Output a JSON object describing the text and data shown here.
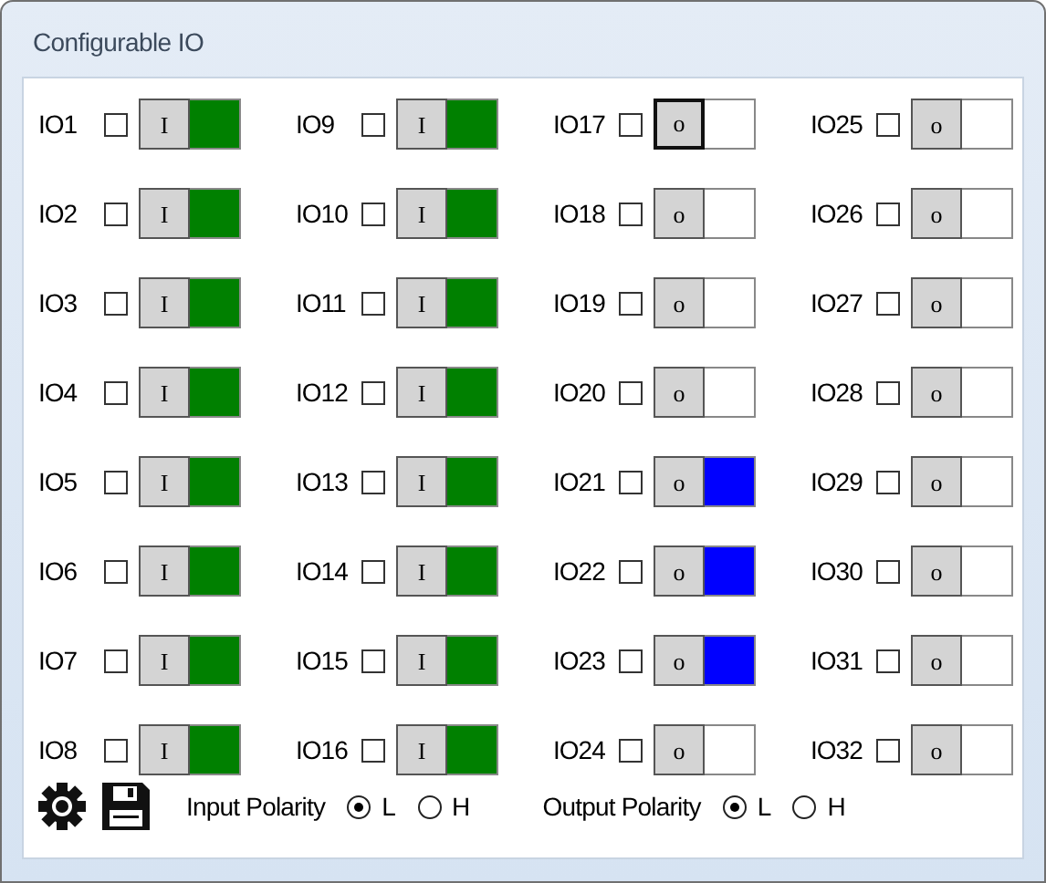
{
  "window": {
    "title": "Configurable IO"
  },
  "ios": [
    {
      "label": "IO1",
      "checked": false,
      "direction": "I",
      "color": "#008000",
      "focused": false
    },
    {
      "label": "IO2",
      "checked": false,
      "direction": "I",
      "color": "#008000",
      "focused": false
    },
    {
      "label": "IO3",
      "checked": false,
      "direction": "I",
      "color": "#008000",
      "focused": false
    },
    {
      "label": "IO4",
      "checked": false,
      "direction": "I",
      "color": "#008000",
      "focused": false
    },
    {
      "label": "IO5",
      "checked": false,
      "direction": "I",
      "color": "#008000",
      "focused": false
    },
    {
      "label": "IO6",
      "checked": false,
      "direction": "I",
      "color": "#008000",
      "focused": false
    },
    {
      "label": "IO7",
      "checked": false,
      "direction": "I",
      "color": "#008000",
      "focused": false
    },
    {
      "label": "IO8",
      "checked": false,
      "direction": "I",
      "color": "#008000",
      "focused": false
    },
    {
      "label": "IO9",
      "checked": false,
      "direction": "I",
      "color": "#008000",
      "focused": false
    },
    {
      "label": "IO10",
      "checked": false,
      "direction": "I",
      "color": "#008000",
      "focused": false
    },
    {
      "label": "IO11",
      "checked": false,
      "direction": "I",
      "color": "#008000",
      "focused": false
    },
    {
      "label": "IO12",
      "checked": false,
      "direction": "I",
      "color": "#008000",
      "focused": false
    },
    {
      "label": "IO13",
      "checked": false,
      "direction": "I",
      "color": "#008000",
      "focused": false
    },
    {
      "label": "IO14",
      "checked": false,
      "direction": "I",
      "color": "#008000",
      "focused": false
    },
    {
      "label": "IO15",
      "checked": false,
      "direction": "I",
      "color": "#008000",
      "focused": false
    },
    {
      "label": "IO16",
      "checked": false,
      "direction": "I",
      "color": "#008000",
      "focused": false
    },
    {
      "label": "IO17",
      "checked": false,
      "direction": "o",
      "color": "#ffffff",
      "focused": true
    },
    {
      "label": "IO18",
      "checked": false,
      "direction": "o",
      "color": "#ffffff",
      "focused": false
    },
    {
      "label": "IO19",
      "checked": false,
      "direction": "o",
      "color": "#ffffff",
      "focused": false
    },
    {
      "label": "IO20",
      "checked": false,
      "direction": "o",
      "color": "#ffffff",
      "focused": false
    },
    {
      "label": "IO21",
      "checked": false,
      "direction": "o",
      "color": "#0000ff",
      "focused": false
    },
    {
      "label": "IO22",
      "checked": false,
      "direction": "o",
      "color": "#0000ff",
      "focused": false
    },
    {
      "label": "IO23",
      "checked": false,
      "direction": "o",
      "color": "#0000ff",
      "focused": false
    },
    {
      "label": "IO24",
      "checked": false,
      "direction": "o",
      "color": "#ffffff",
      "focused": false
    },
    {
      "label": "IO25",
      "checked": false,
      "direction": "o",
      "color": "#ffffff",
      "focused": false
    },
    {
      "label": "IO26",
      "checked": false,
      "direction": "o",
      "color": "#ffffff",
      "focused": false
    },
    {
      "label": "IO27",
      "checked": false,
      "direction": "o",
      "color": "#ffffff",
      "focused": false
    },
    {
      "label": "IO28",
      "checked": false,
      "direction": "o",
      "color": "#ffffff",
      "focused": false
    },
    {
      "label": "IO29",
      "checked": false,
      "direction": "o",
      "color": "#ffffff",
      "focused": false
    },
    {
      "label": "IO30",
      "checked": false,
      "direction": "o",
      "color": "#ffffff",
      "focused": false
    },
    {
      "label": "IO31",
      "checked": false,
      "direction": "o",
      "color": "#ffffff",
      "focused": false
    },
    {
      "label": "IO32",
      "checked": false,
      "direction": "o",
      "color": "#ffffff",
      "focused": false
    }
  ],
  "polarity": [
    {
      "label": "Input Polarity",
      "options": [
        {
          "label": "L",
          "selected": true
        },
        {
          "label": "H",
          "selected": false
        }
      ]
    },
    {
      "label": "Output Polarity",
      "options": [
        {
          "label": "L",
          "selected": true
        },
        {
          "label": "H",
          "selected": false
        }
      ]
    }
  ]
}
